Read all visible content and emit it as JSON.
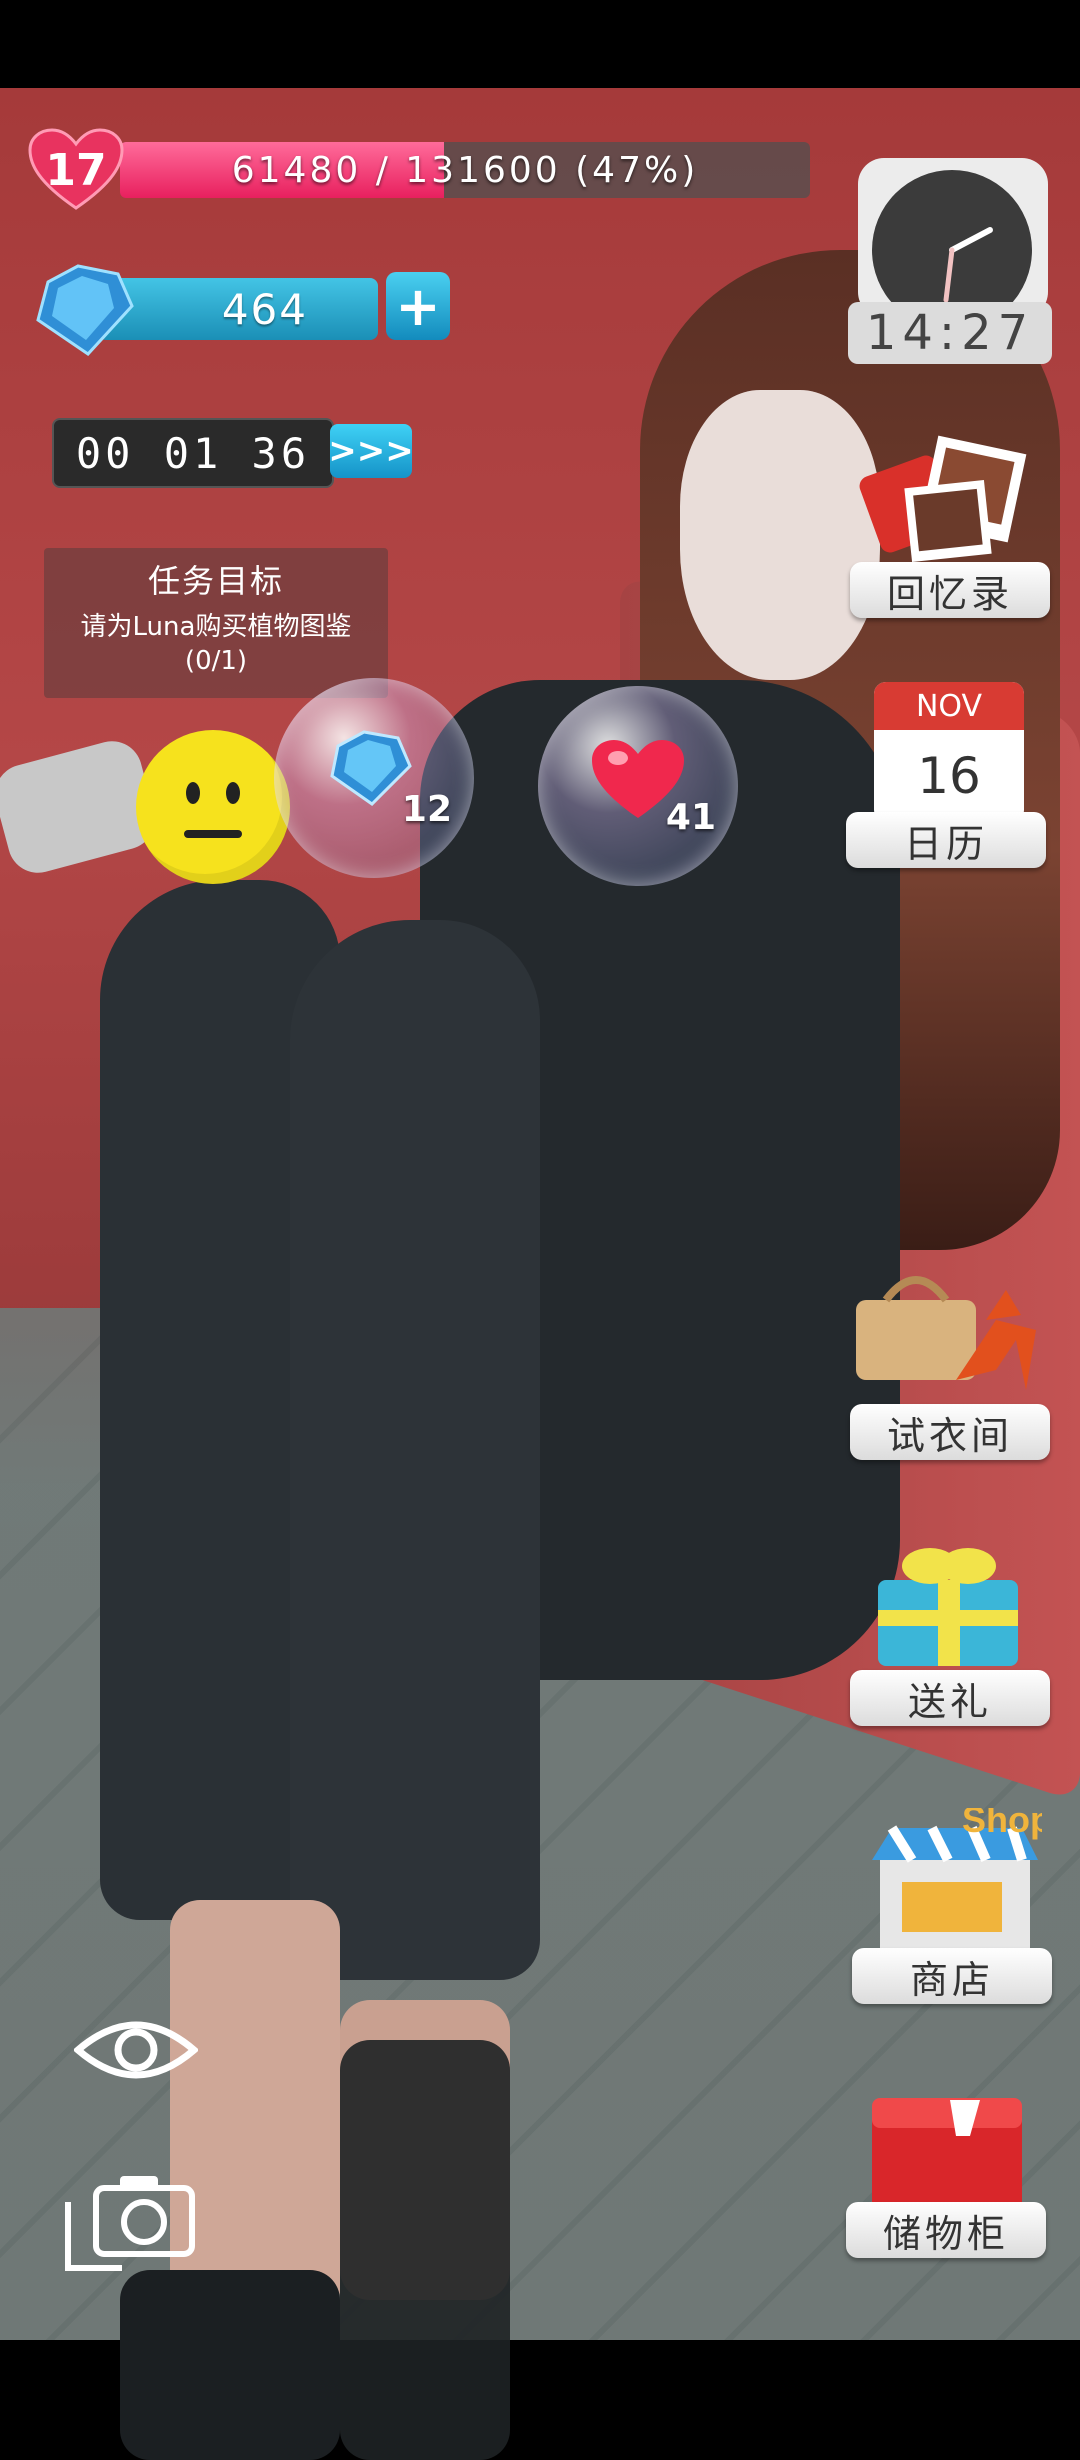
{
  "hud": {
    "level": "17",
    "xp_text": "61480 / 131600 (47%)",
    "xp_progress": 0.47,
    "gems": "464",
    "gems_plus": "+",
    "timer": "00 01 36",
    "timer_skip": ">>>"
  },
  "mission": {
    "title": "任务目标",
    "description": "请为Luna购买植物图鉴",
    "progress": "(0/1)"
  },
  "bubbles": {
    "gem_count": "12",
    "heart_count": "41"
  },
  "menu": {
    "clock_time": "14:27",
    "memories_label": "回忆录",
    "calendar_month": "NOV",
    "calendar_day": "16",
    "calendar_label": "日历",
    "dressing_label": "试衣间",
    "gift_label": "送礼",
    "shop_label": "商店",
    "shop_sign": "Shop",
    "locker_label": "储物柜"
  },
  "colors": {
    "xp_fill": "#e8205e",
    "gem_bar": "#1b8fb6",
    "mood": "#f6e21d"
  }
}
